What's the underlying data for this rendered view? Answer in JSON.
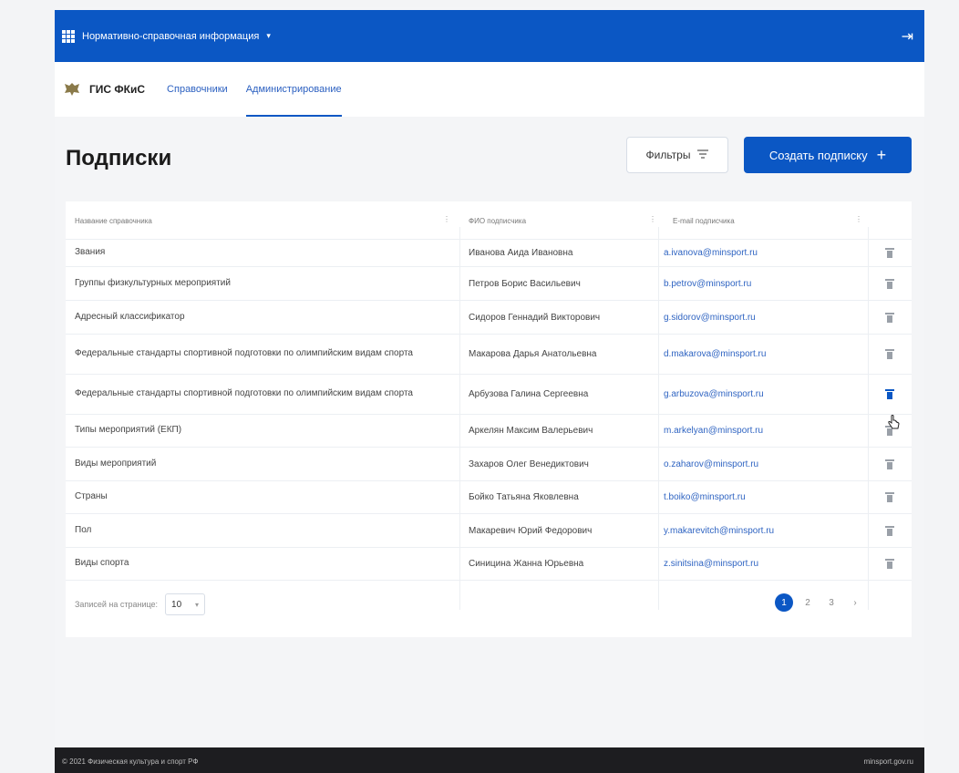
{
  "topbar": {
    "app_name": "Нормативно-справочная информация",
    "caret": "▾",
    "logout_glyph": "⇥"
  },
  "header": {
    "brand": "ГИС ФКиС",
    "tabs": [
      {
        "label": "Справочники",
        "active": false
      },
      {
        "label": "Администрирование",
        "active": true
      }
    ]
  },
  "page": {
    "title": "Подписки"
  },
  "actions": {
    "filter_label": "Фильтры",
    "create_label": "Создать подписку",
    "create_plus": "+"
  },
  "table": {
    "headers": [
      "Название справочника",
      "ФИО подписчика",
      "E-mail подписчика"
    ],
    "rows": [
      {
        "name": "Звания",
        "fio": "Иванова Аида Ивановна",
        "email": "a.ivanova@minsport.ru"
      },
      {
        "name": "Группы физкультурных мероприятий",
        "fio": "Петров Борис Васильевич",
        "email": "b.petrov@minsport.ru"
      },
      {
        "name": "Адресный классификатор",
        "fio": "Сидоров Геннадий Викторович",
        "email": "g.sidorov@minsport.ru"
      },
      {
        "name": "Федеральные стандарты спортивной подготовки по олимпийским видам спорта",
        "fio": "Макарова Дарья Анатольевна",
        "email": "d.makarova@minsport.ru"
      },
      {
        "name": "Федеральные стандарты спортивной подготовки по олимпийским видам спорта",
        "fio": "Арбузова Галина Сергеевна",
        "email": "g.arbuzova@minsport.ru"
      },
      {
        "name": "Типы мероприятий (ЕКП)",
        "fio": "Аркелян Максим Валерьевич",
        "email": "m.arkelyan@minsport.ru"
      },
      {
        "name": "Виды мероприятий",
        "fio": "Захаров Олег Венедиктович",
        "email": "o.zaharov@minsport.ru"
      },
      {
        "name": "Страны",
        "fio": "Бойко Татьяна Яковлевна",
        "email": "t.boiko@minsport.ru"
      },
      {
        "name": "Пол",
        "fio": "Макаревич Юрий Федорович",
        "email": "y.makarevitch@minsport.ru"
      },
      {
        "name": "Виды спорта",
        "fio": "Синицина Жанна Юрьевна",
        "email": "z.sinitsina@minsport.ru"
      }
    ]
  },
  "pagination": {
    "rows_per_page_label": "Записей на странице:",
    "rows_per_page_value": "10",
    "pages": [
      "1",
      "2",
      "3"
    ],
    "current_page": "1",
    "next": "›"
  },
  "footer": {
    "copyright": "© 2021 Физическая культура и спорт РФ",
    "site": "minsport.gov.ru"
  }
}
